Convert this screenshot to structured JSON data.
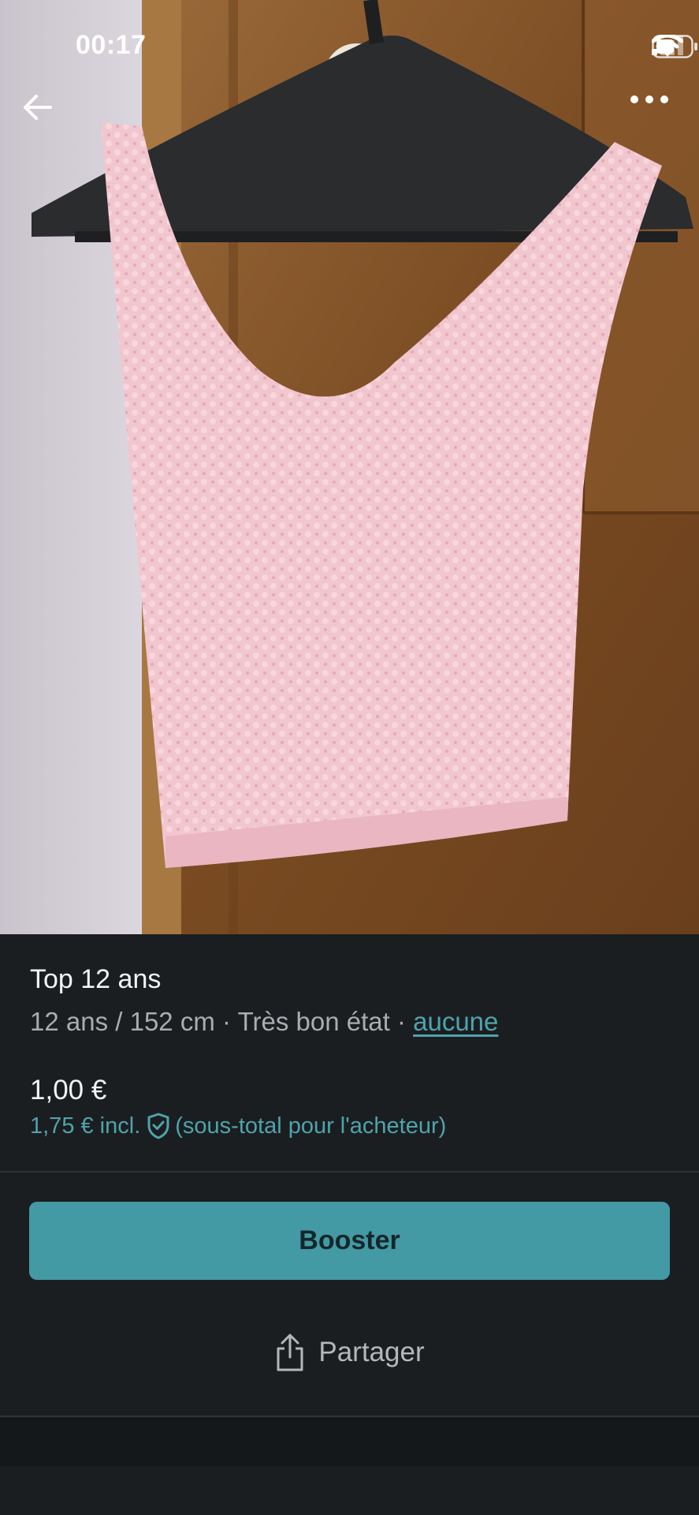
{
  "status_bar": {
    "time": "00:17",
    "icons": [
      "signal-icon",
      "wifi-icon",
      "battery-icon"
    ]
  },
  "toolbar": {
    "back_icon": "arrow-left-icon",
    "more_icon": "more-horizontal-icon"
  },
  "product": {
    "title": "Top 12 ans",
    "size": "12 ans / 152 cm",
    "separator": "·",
    "condition": "Très bon état",
    "brand": "aucune",
    "price": "1,00 €",
    "price_incl": "1,75 € incl.",
    "price_incl_note": "(sous-total pour l'acheteur)"
  },
  "actions": {
    "boost_label": "Booster",
    "share_label": "Partager"
  },
  "colors": {
    "accent": "#4399a4",
    "link": "#4fa3ad",
    "background": "#1b1e20"
  }
}
